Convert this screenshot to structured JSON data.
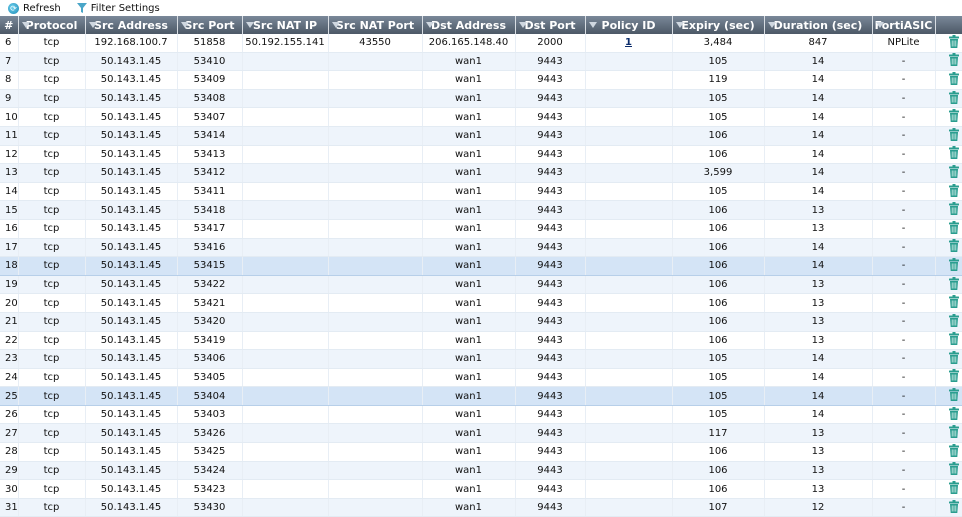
{
  "toolbar": {
    "refresh_label": "Refresh",
    "filter_label": "Filter Settings"
  },
  "columns": [
    "#",
    "Protocol",
    "Src Address",
    "Src Port",
    "Src NAT IP",
    "Src NAT Port",
    "Dst Address",
    "Dst Port",
    "Policy ID",
    "Expiry (sec)",
    "Duration (sec)",
    "FortiASIC",
    ""
  ],
  "rows": [
    [
      "6",
      "tcp",
      "192.168.100.7",
      "51858",
      "50.192.155.141",
      "43550",
      "206.165.148.40",
      "2000",
      "1",
      "3,484",
      "847",
      "NPLite"
    ],
    [
      "7",
      "tcp",
      "50.143.1.45",
      "53410",
      "",
      "",
      "wan1",
      "9443",
      "",
      "105",
      "14",
      "-"
    ],
    [
      "8",
      "tcp",
      "50.143.1.45",
      "53409",
      "",
      "",
      "wan1",
      "9443",
      "",
      "119",
      "14",
      "-"
    ],
    [
      "9",
      "tcp",
      "50.143.1.45",
      "53408",
      "",
      "",
      "wan1",
      "9443",
      "",
      "105",
      "14",
      "-"
    ],
    [
      "10",
      "tcp",
      "50.143.1.45",
      "53407",
      "",
      "",
      "wan1",
      "9443",
      "",
      "105",
      "14",
      "-"
    ],
    [
      "11",
      "tcp",
      "50.143.1.45",
      "53414",
      "",
      "",
      "wan1",
      "9443",
      "",
      "106",
      "14",
      "-"
    ],
    [
      "12",
      "tcp",
      "50.143.1.45",
      "53413",
      "",
      "",
      "wan1",
      "9443",
      "",
      "106",
      "14",
      "-"
    ],
    [
      "13",
      "tcp",
      "50.143.1.45",
      "53412",
      "",
      "",
      "wan1",
      "9443",
      "",
      "3,599",
      "14",
      "-"
    ],
    [
      "14",
      "tcp",
      "50.143.1.45",
      "53411",
      "",
      "",
      "wan1",
      "9443",
      "",
      "105",
      "14",
      "-"
    ],
    [
      "15",
      "tcp",
      "50.143.1.45",
      "53418",
      "",
      "",
      "wan1",
      "9443",
      "",
      "106",
      "13",
      "-"
    ],
    [
      "16",
      "tcp",
      "50.143.1.45",
      "53417",
      "",
      "",
      "wan1",
      "9443",
      "",
      "106",
      "13",
      "-"
    ],
    [
      "17",
      "tcp",
      "50.143.1.45",
      "53416",
      "",
      "",
      "wan1",
      "9443",
      "",
      "106",
      "14",
      "-"
    ],
    [
      "18",
      "tcp",
      "50.143.1.45",
      "53415",
      "",
      "",
      "wan1",
      "9443",
      "",
      "106",
      "14",
      "-"
    ],
    [
      "19",
      "tcp",
      "50.143.1.45",
      "53422",
      "",
      "",
      "wan1",
      "9443",
      "",
      "106",
      "13",
      "-"
    ],
    [
      "20",
      "tcp",
      "50.143.1.45",
      "53421",
      "",
      "",
      "wan1",
      "9443",
      "",
      "106",
      "13",
      "-"
    ],
    [
      "21",
      "tcp",
      "50.143.1.45",
      "53420",
      "",
      "",
      "wan1",
      "9443",
      "",
      "106",
      "13",
      "-"
    ],
    [
      "22",
      "tcp",
      "50.143.1.45",
      "53419",
      "",
      "",
      "wan1",
      "9443",
      "",
      "106",
      "13",
      "-"
    ],
    [
      "23",
      "tcp",
      "50.143.1.45",
      "53406",
      "",
      "",
      "wan1",
      "9443",
      "",
      "105",
      "14",
      "-"
    ],
    [
      "24",
      "tcp",
      "50.143.1.45",
      "53405",
      "",
      "",
      "wan1",
      "9443",
      "",
      "105",
      "14",
      "-"
    ],
    [
      "25",
      "tcp",
      "50.143.1.45",
      "53404",
      "",
      "",
      "wan1",
      "9443",
      "",
      "105",
      "14",
      "-"
    ],
    [
      "26",
      "tcp",
      "50.143.1.45",
      "53403",
      "",
      "",
      "wan1",
      "9443",
      "",
      "105",
      "14",
      "-"
    ],
    [
      "27",
      "tcp",
      "50.143.1.45",
      "53426",
      "",
      "",
      "wan1",
      "9443",
      "",
      "117",
      "13",
      "-"
    ],
    [
      "28",
      "tcp",
      "50.143.1.45",
      "53425",
      "",
      "",
      "wan1",
      "9443",
      "",
      "106",
      "13",
      "-"
    ],
    [
      "29",
      "tcp",
      "50.143.1.45",
      "53424",
      "",
      "",
      "wan1",
      "9443",
      "",
      "106",
      "13",
      "-"
    ],
    [
      "30",
      "tcp",
      "50.143.1.45",
      "53423",
      "",
      "",
      "wan1",
      "9443",
      "",
      "106",
      "13",
      "-"
    ],
    [
      "31",
      "tcp",
      "50.143.1.45",
      "53430",
      "",
      "",
      "wan1",
      "9443",
      "",
      "107",
      "12",
      "-"
    ]
  ],
  "selected_rows": [
    "18",
    "25"
  ],
  "icons": {
    "refresh": "refresh-icon",
    "filter": "filter-icon",
    "delete": "trash-icon",
    "sort": "sort-triangle-icon"
  },
  "colors": {
    "header": "#5e6b7a",
    "row_alt": "#eef4fb",
    "row_selected": "#d4e4f6",
    "trash": "#2a9d8f"
  }
}
